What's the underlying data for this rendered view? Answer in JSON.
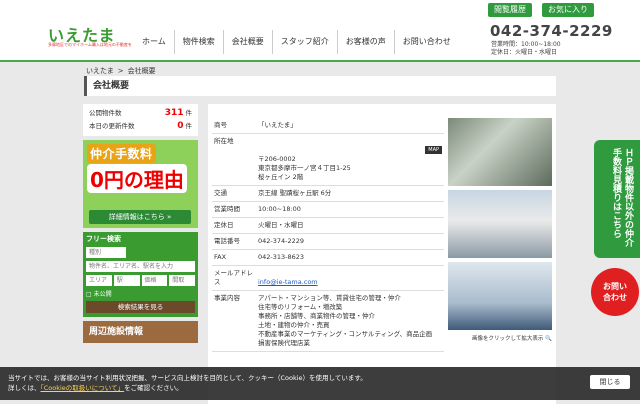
{
  "topbar": {
    "history": "閲覧履歴",
    "favorites": "お気に入り"
  },
  "header": {
    "logo": "いえたま",
    "logo_sub": "多摩地区でのマイホーム購入は地元の不動産を",
    "nav": [
      "ホーム",
      "物件検索",
      "会社概要",
      "スタッフ紹介",
      "お客様の声",
      "お問い合わせ"
    ],
    "phone": "042-374-2229",
    "hours": "営業時間：10:00~18:00",
    "closed": "定休日：火曜日・水曜日"
  },
  "breadcrumb": {
    "home": "いえたま",
    "sep": ">",
    "current": "会社概要"
  },
  "page_title": "会社概要",
  "stats": {
    "public_label": "公開物件数",
    "public_count": "311",
    "unit": "件",
    "today_label": "本日の更新件数",
    "today_count": "0"
  },
  "banner": {
    "line1": "仲介手数料",
    "line2": "0円の理由",
    "button": "詳細情報はこちら »"
  },
  "search": {
    "title": "フリー検索",
    "type_placeholder": "種別",
    "keyword_placeholder": "物件名、エリア名、駅名を入力",
    "area": "エリア",
    "station": "駅",
    "price": "価格",
    "layout": "間取",
    "check_label": "□ 未公開",
    "button": "検索結果を見る"
  },
  "nearby": "周辺施設情報",
  "company": [
    {
      "k": "商号",
      "v": "「いえたま」"
    },
    {
      "k": "所在地",
      "v": "〒206-0002\n東京都多摩市一ノ宮４丁目1-25\n桜ヶ丘イン 2階",
      "map": "MAP"
    },
    {
      "k": "交通",
      "v": "京王線 聖蹟桜ヶ丘駅 6分"
    },
    {
      "k": "営業時間",
      "v": "10:00~18:00"
    },
    {
      "k": "定休日",
      "v": "火曜日・水曜日"
    },
    {
      "k": "電話番号",
      "v": "042-374-2229"
    },
    {
      "k": "FAX",
      "v": "042-313-8623"
    },
    {
      "k": "メールアドレス",
      "v": "info@ie-tama.com",
      "link": true
    },
    {
      "k": "事業内容",
      "v": "アパート・マンション等、賃貸住宅の管理・仲介\n住宅等のリフォーム・増改築\n事務所・店舗等、商業物件の管理・仲介\n土地・建物の仲介・売買\n不動産事業のマーケティング・コンサルティング、商品企画\n損害保険代理店業"
    }
  ],
  "photo_caption": "画像をクリックして拡大表示",
  "float_tab": "ＨＰ掲載物件以外の仲介手数料見積りはこちら",
  "contact": {
    "line1": "お問い",
    "line2": "合わせ"
  },
  "cookie": {
    "line1": "当サイトでは、お客様の当サイト利用状況把握、サービス向上検討を目的として、クッキー（Cookie）を使用しています。",
    "line2a": "詳しくは、",
    "link": "「Cookieの取扱いについて」",
    "line2b": "をご確認ください。",
    "close": "閉じる"
  }
}
